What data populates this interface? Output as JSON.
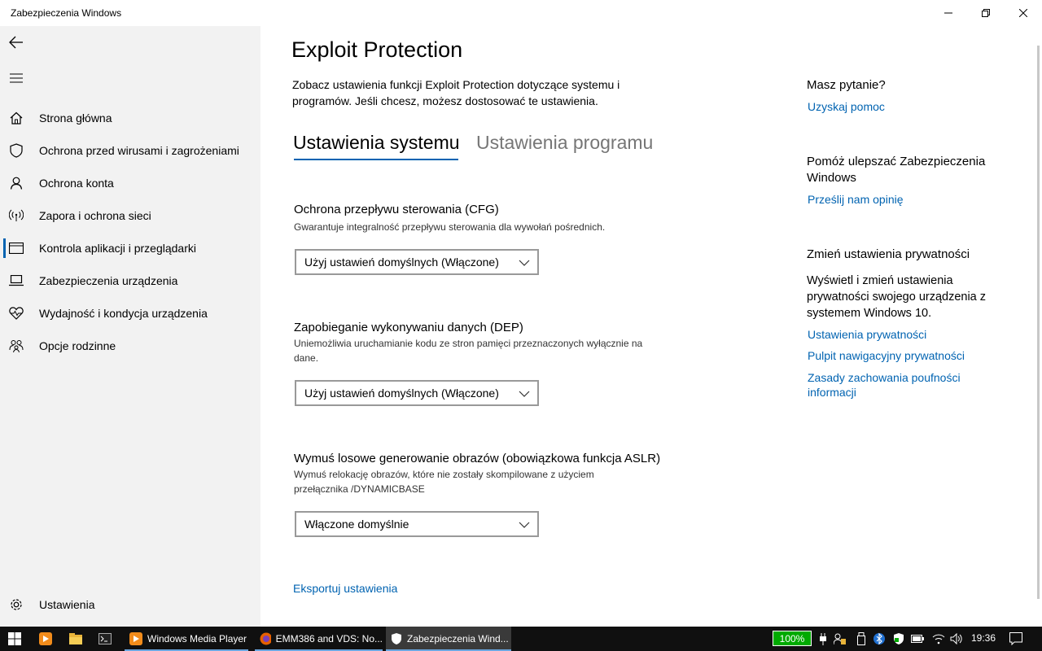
{
  "window": {
    "title": "Zabezpieczenia Windows"
  },
  "sidebar": {
    "items": [
      {
        "label": "Strona główna",
        "icon": "home-icon"
      },
      {
        "label": "Ochrona przed wirusami i zagrożeniami",
        "icon": "shield-icon"
      },
      {
        "label": "Ochrona konta",
        "icon": "person-icon"
      },
      {
        "label": "Zapora i ochrona sieci",
        "icon": "wireless-icon"
      },
      {
        "label": "Kontrola aplikacji i przeglądarki",
        "icon": "app-browser-icon",
        "active": true
      },
      {
        "label": "Zabezpieczenia urządzenia",
        "icon": "laptop-icon"
      },
      {
        "label": "Wydajność i kondycja urządzenia",
        "icon": "heart-icon"
      },
      {
        "label": "Opcje rodzinne",
        "icon": "family-icon"
      }
    ],
    "settings_label": "Ustawienia"
  },
  "main": {
    "title": "Exploit Protection",
    "description": "Zobacz ustawienia funkcji Exploit Protection dotyczące systemu i programów. Jeśli chcesz, możesz dostosować te ustawienia.",
    "tabs": [
      {
        "label": "Ustawienia systemu",
        "active": true
      },
      {
        "label": "Ustawienia programu",
        "active": false
      }
    ],
    "sections": [
      {
        "title": "Ochrona przepływu sterowania (CFG)",
        "description": "Gwarantuje integralność przepływu sterowania dla wywołań pośrednich.",
        "value": "Użyj ustawień domyślnych (Włączone)"
      },
      {
        "title": "Zapobieganie wykonywaniu danych (DEP)",
        "description": "Uniemożliwia uruchamianie kodu ze stron pamięci przeznaczonych wyłącznie na dane.",
        "value": "Użyj ustawień domyślnych (Włączone)"
      },
      {
        "title": "Wymuś losowe generowanie obrazów (obowiązkowa funkcja ASLR)",
        "description": "Wymuś relokację obrazów, które nie zostały skompilowane z użyciem przełącznika /DYNAMICBASE",
        "value": "Włączone domyślnie"
      }
    ],
    "export_label": "Eksportuj ustawienia"
  },
  "right": {
    "question_heading": "Masz pytanie?",
    "help_link": "Uzyskaj pomoc",
    "improve_heading": "Pomóż ulepszać Zabezpieczenia Windows",
    "feedback_link": "Prześlij nam opinię",
    "privacy_heading": "Zmień ustawienia prywatności",
    "privacy_text": "Wyświetl i zmień ustawienia prywatności swojego urządzenia z systemem Windows 10.",
    "privacy_links": [
      "Ustawienia prywatności",
      "Pulpit nawigacyjny prywatności",
      "Zasady zachowania poufności informacji"
    ]
  },
  "taskbar": {
    "apps": [
      {
        "label": "Windows Media Player",
        "icon": "media-player-icon"
      },
      {
        "label": "EMM386 and VDS: No...",
        "icon": "firefox-icon"
      },
      {
        "label": "Zabezpieczenia Wind...",
        "icon": "shield-icon"
      }
    ],
    "battery": "100%",
    "time": "19:36"
  },
  "colors": {
    "accent": "#0063b1",
    "sidebar_bg": "#f2f2f2",
    "taskbar_bg": "#101010"
  }
}
